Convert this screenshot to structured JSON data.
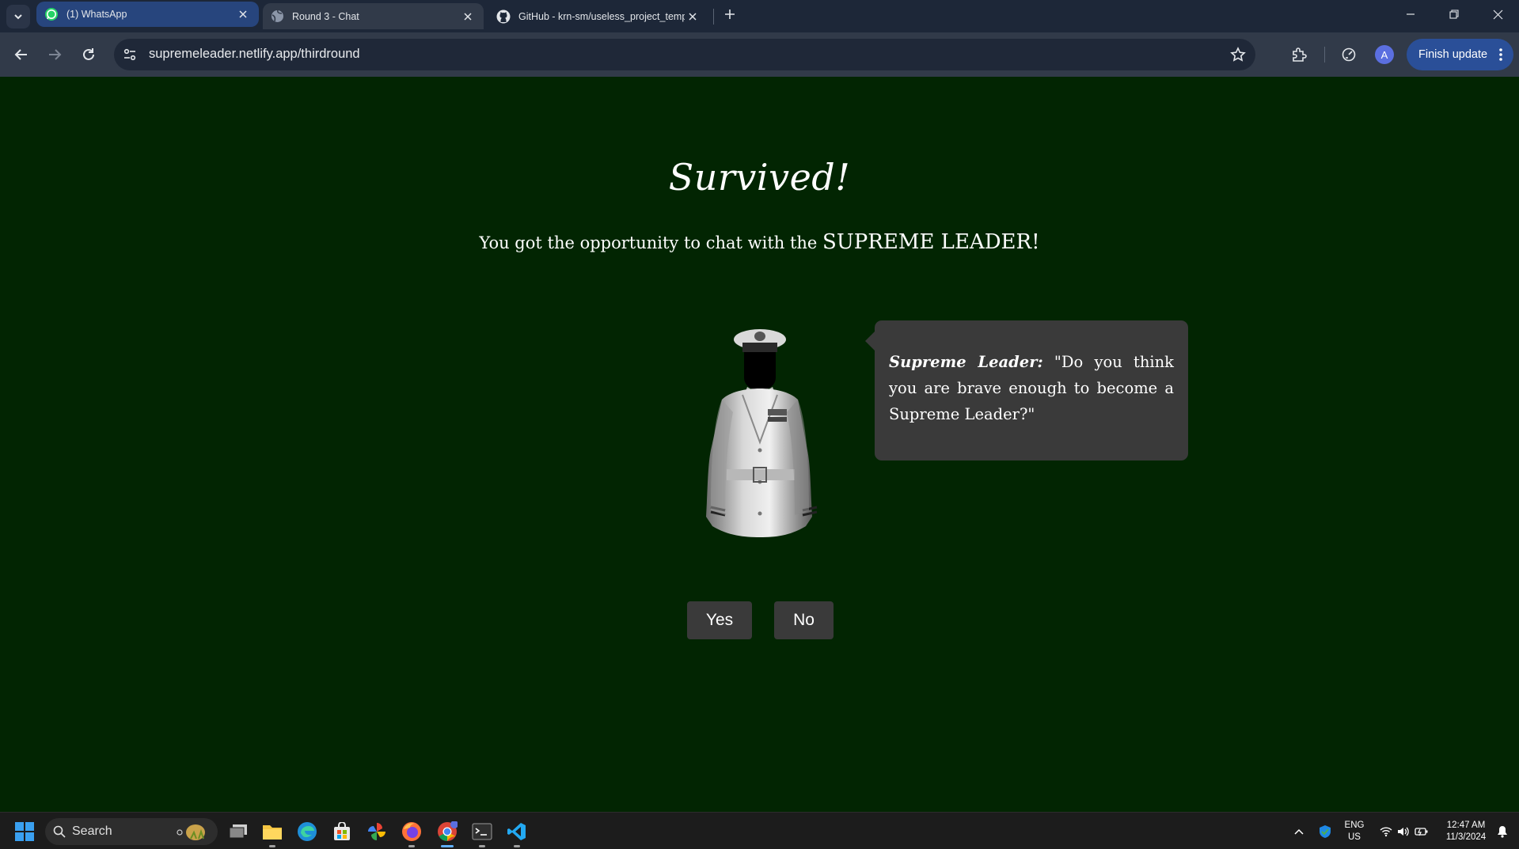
{
  "browser": {
    "tabs": [
      {
        "label": "(1) WhatsApp",
        "icon": "whatsapp-icon"
      },
      {
        "label": "Round 3 - Chat",
        "icon": "globe-icon"
      },
      {
        "label": "GitHub - krn-sm/useless_project_temp",
        "icon": "github-icon"
      }
    ],
    "url": "supremeleader.netlify.app/thirdround",
    "profile_initial": "A",
    "finish_update_label": "Finish update"
  },
  "page": {
    "title": "Survived!",
    "subtitle_prefix": "You got the opportunity to chat with the ",
    "subtitle_emphasis": "SUPREME LEADER!",
    "speaker": "Supreme Leader:",
    "quote": " \"Do you think you are brave enough to become a Supreme Leader?\"",
    "yes_label": "Yes",
    "no_label": "No"
  },
  "taskbar": {
    "search_label": "Search",
    "language": "ENG",
    "region": "US",
    "time": "12:47 AM",
    "date": "11/3/2024"
  },
  "colors": {
    "page_background": "#022502",
    "bubble_background": "#3a3a3a",
    "button_background": "#3a3a3a",
    "active_tab": "#27457d",
    "finish_update": "#2a4f98"
  }
}
